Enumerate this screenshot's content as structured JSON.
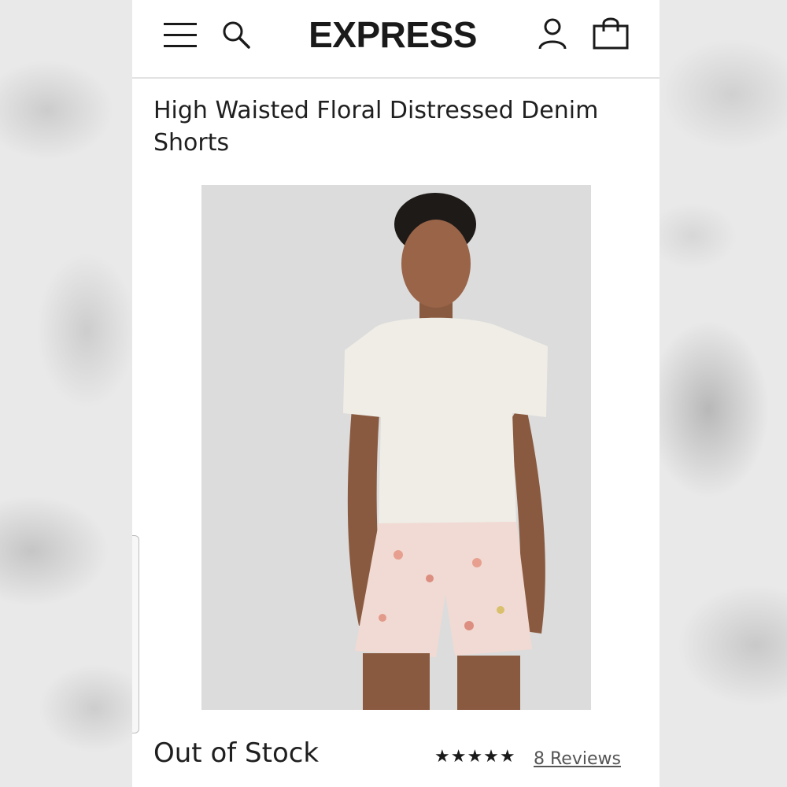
{
  "header": {
    "logo": "EXPRESS",
    "icons": [
      "menu-icon",
      "search-icon",
      "account-icon",
      "shopping-bag-icon"
    ]
  },
  "product": {
    "title": "High Waisted Floral Distressed Denim Shorts",
    "image_alt": "Model wearing white t-shirt and floral denim shorts",
    "stock_status": "Out of Stock",
    "rating_stars": "★★★★★",
    "rating": 5,
    "reviews_link": "8 Reviews"
  },
  "colors": {
    "text": "#1f1f1f",
    "divider": "#e2e2e2",
    "image_bg": "#dcdcdc"
  }
}
